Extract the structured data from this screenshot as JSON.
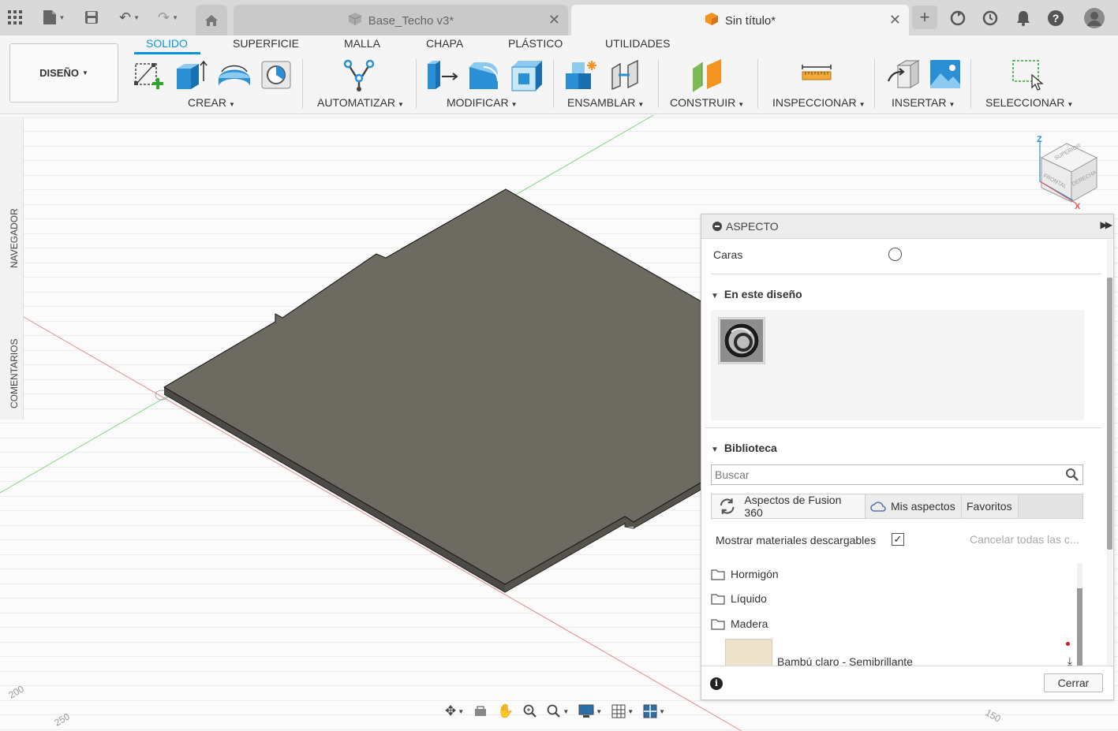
{
  "titlebar": {
    "tabs": [
      {
        "title": "Base_Techo v3*",
        "active": false
      },
      {
        "title": "Sin título*",
        "active": true
      }
    ],
    "icons": [
      "grid-menu-icon",
      "file-icon",
      "save-icon",
      "undo-icon",
      "redo-icon",
      "home-icon",
      "plus-icon",
      "sync-icon",
      "history-icon",
      "notification-icon",
      "help-icon",
      "avatar"
    ]
  },
  "ribbon": {
    "workspace_button": "DISEÑO",
    "tabs": [
      "SOLIDO",
      "SUPERFICIE",
      "MALLA",
      "CHAPA",
      "PLÁSTICO",
      "UTILIDADES"
    ],
    "active_tab": "SOLIDO",
    "groups": [
      "CREAR",
      "AUTOMATIZAR",
      "MODIFICAR",
      "ENSAMBLAR",
      "CONSTRUIR",
      "INSPECCIONAR",
      "INSERTAR",
      "SELECCIONAR"
    ],
    "accent_color": "#0696d7"
  },
  "left_panels": {
    "navigator": "NAVEGADOR",
    "comments": "COMENTARIOS"
  },
  "viewcube": {
    "top": "SUPERIOR",
    "front": "FRONTAL",
    "right": "DERECHA",
    "z": "Z",
    "x": "X"
  },
  "grid_labels": [
    "200",
    "250",
    "150"
  ],
  "appearance_panel": {
    "title": "ASPECTO",
    "faces_label": "Caras",
    "in_design_section": "En este diseño",
    "library_section": "Biblioteca",
    "search_placeholder": "Buscar",
    "library_tabs": [
      "Aspectos de Fusion 360",
      "Mis aspectos",
      "Favoritos"
    ],
    "show_downloadable": "Mostrar materiales descargables",
    "show_downloadable_checked": true,
    "cancel_all": "Cancelar todas las c...",
    "folders": [
      "Hormigón",
      "Líquido",
      "Madera"
    ],
    "material_item": "Bambú claro - Semibrillante",
    "close_button": "Cerrar"
  }
}
